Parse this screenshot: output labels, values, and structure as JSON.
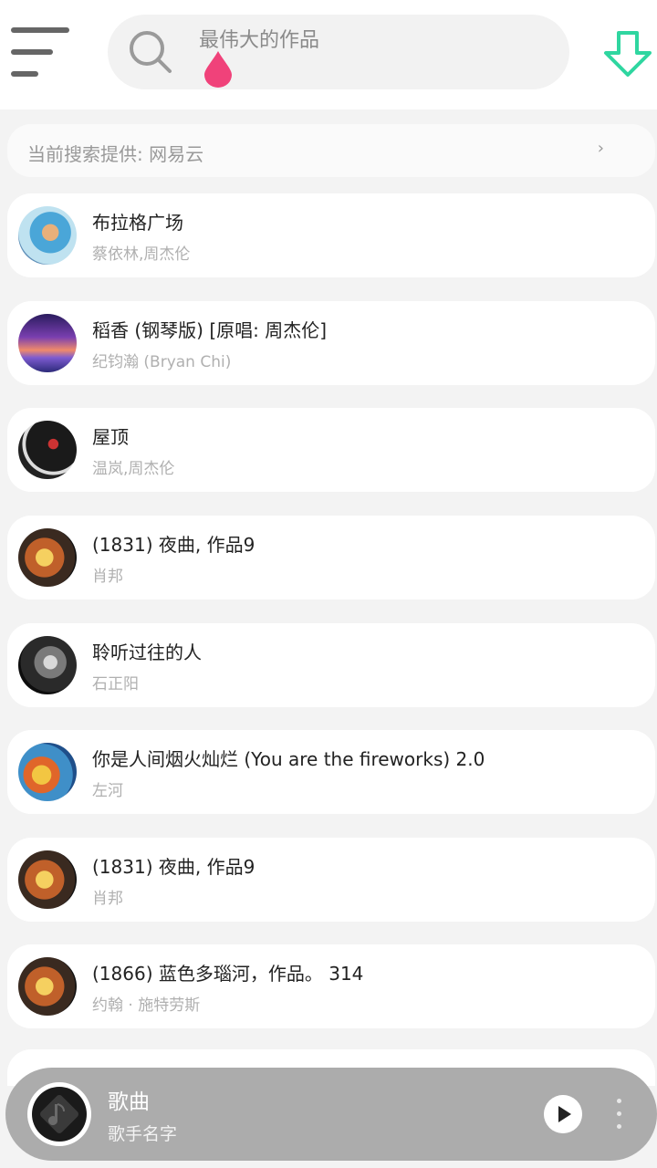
{
  "search": {
    "placeholder": "最伟大的作品"
  },
  "source_bar": {
    "label": "当前搜索提供: 网易云",
    "arrow": "›"
  },
  "songs": [
    {
      "title": "布拉格广场",
      "artist": "蔡依林,周杰伦"
    },
    {
      "title": "稻香 (钢琴版) [原唱: 周杰伦]",
      "artist": "纪钧瀚 (Bryan Chi)"
    },
    {
      "title": "屋顶",
      "artist": "温岚,周杰伦"
    },
    {
      "title": "(1831) 夜曲, 作品9",
      "artist": "肖邦"
    },
    {
      "title": "聆听过往的人",
      "artist": "石正阳"
    },
    {
      "title": "你是人间烟火灿烂 (You are the fireworks) 2.0",
      "artist": "左河"
    },
    {
      "title": "(1831) 夜曲, 作品9",
      "artist": "肖邦"
    },
    {
      "title": "(1866) 蓝色多瑙河，作品。 314",
      "artist": "约翰 · 施特劳斯"
    }
  ],
  "player": {
    "title": "歌曲",
    "artist": "歌手名字"
  },
  "colors": {
    "accent_green": "#2fd6a0",
    "drop_pink": "#f0427a",
    "player_bg": "#acacac"
  },
  "icons": {
    "menu": "menu-icon",
    "search": "search-icon",
    "download": "download-arrow-icon",
    "play": "play-icon",
    "more": "more-vertical-icon"
  }
}
